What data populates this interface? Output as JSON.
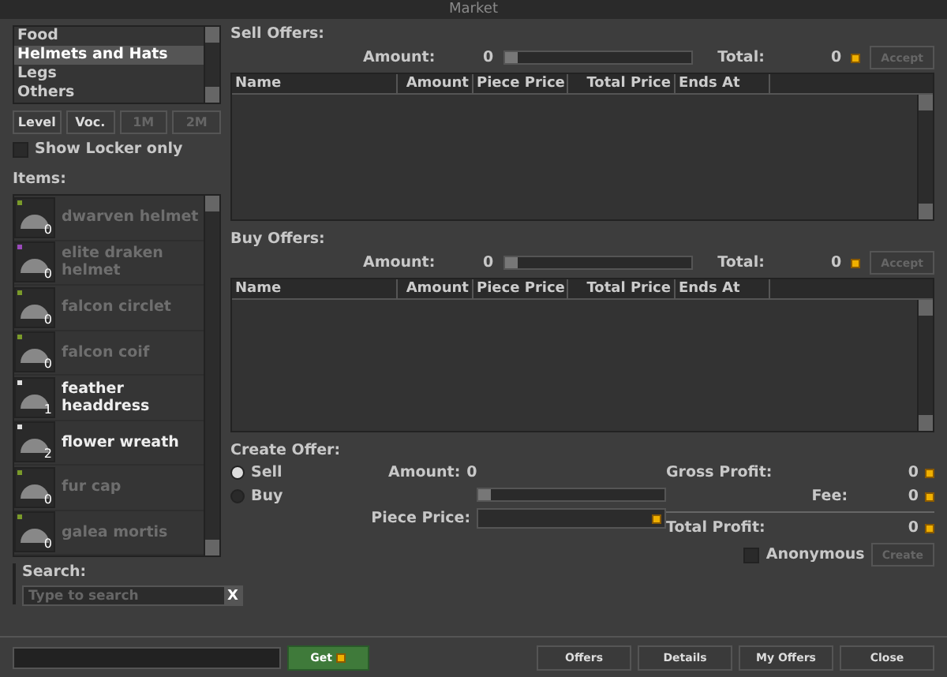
{
  "window": {
    "title": "Market"
  },
  "categories": [
    {
      "label": "Food",
      "selected": false
    },
    {
      "label": "Helmets and Hats",
      "selected": true
    },
    {
      "label": "Legs",
      "selected": false
    },
    {
      "label": "Others",
      "selected": false
    }
  ],
  "filters": [
    {
      "label": "Level",
      "disabled": false
    },
    {
      "label": "Voc.",
      "disabled": false
    },
    {
      "label": "1M",
      "disabled": true
    },
    {
      "label": "2M",
      "disabled": true
    }
  ],
  "show_locker_only": {
    "label": "Show Locker only",
    "checked": false
  },
  "items_label": "Items:",
  "items": [
    {
      "name": "dwarven helmet",
      "count": "0",
      "disabled": true,
      "color": "#7a9a2a"
    },
    {
      "name": "elite draken helmet",
      "count": "0",
      "disabled": true,
      "color": "#9a4aba"
    },
    {
      "name": "falcon circlet",
      "count": "0",
      "disabled": true,
      "color": "#7a9a2a"
    },
    {
      "name": "falcon coif",
      "count": "0",
      "disabled": true,
      "color": "#7a9a2a"
    },
    {
      "name": "feather headdress",
      "count": "1",
      "disabled": false,
      "color": "#e0e0e0"
    },
    {
      "name": "flower wreath",
      "count": "2",
      "disabled": false,
      "color": "#e0e0e0"
    },
    {
      "name": "fur cap",
      "count": "0",
      "disabled": true,
      "color": "#7a9a2a"
    },
    {
      "name": "galea mortis",
      "count": "0",
      "disabled": true,
      "color": "#7a9a2a"
    }
  ],
  "search": {
    "label": "Search:",
    "placeholder": "Type to search",
    "clear": "X"
  },
  "get_button": "Get",
  "offer_sections": [
    {
      "title": "Sell Offers:",
      "amount_label": "Amount:",
      "amount": "0",
      "level": 0,
      "total_label": "Total:",
      "total": "0",
      "accept": "Accept",
      "columns": [
        "Name",
        "Amount",
        "Piece Price",
        "Total Price",
        "Ends At"
      ]
    },
    {
      "title": "Buy Offers:",
      "amount_label": "Amount:",
      "amount": "0",
      "level": 0,
      "total_label": "Total:",
      "total": "0",
      "accept": "Accept",
      "columns": [
        "Name",
        "Amount",
        "Piece Price",
        "Total Price",
        "Ends At"
      ]
    }
  ],
  "create_offer": {
    "title": "Create Offer:",
    "types": [
      {
        "label": "Sell",
        "selected": true
      },
      {
        "label": "Buy",
        "selected": false
      }
    ],
    "amount_label": "Amount:",
    "amount": "0",
    "level": 0,
    "piece_price_label": "Piece Price:",
    "gross_label": "Gross Profit:",
    "gross": "0",
    "fee_label": "Fee:",
    "fee": "0",
    "total_label": "Total Profit:",
    "total": "0",
    "anonymous": {
      "label": "Anonymous",
      "checked": false
    },
    "create": "Create"
  },
  "buttons": [
    "Offers",
    "Details",
    "My Offers",
    "Close"
  ]
}
